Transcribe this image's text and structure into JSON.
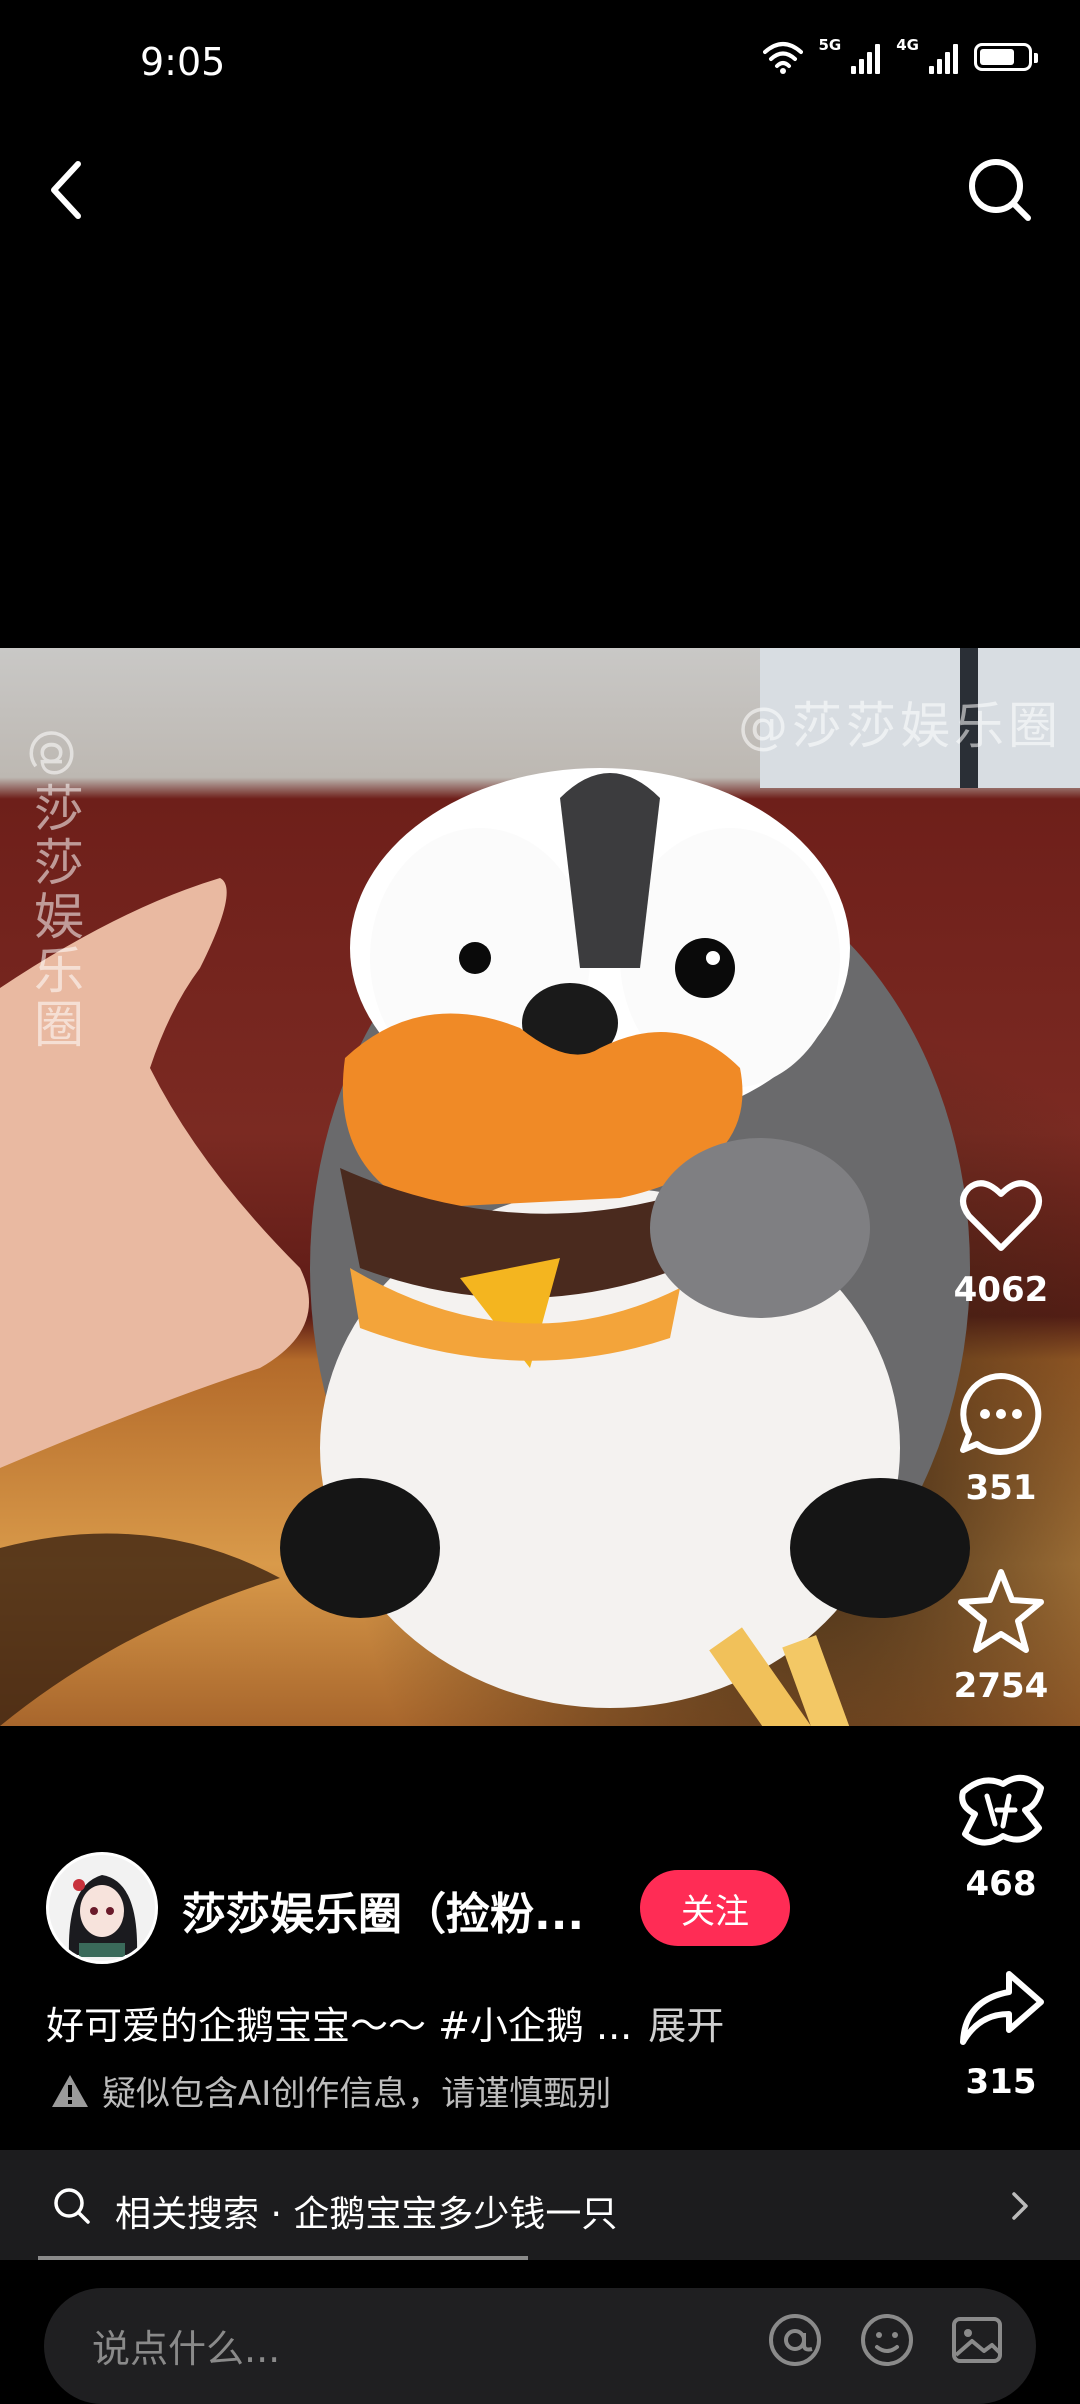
{
  "status_bar": {
    "time": "9:05",
    "net1": "5G",
    "net2": "4G"
  },
  "video": {
    "watermark_top": "@莎莎娱乐圈",
    "watermark_side": "@莎莎娱乐圈"
  },
  "actions": {
    "like_count": "4062",
    "comment_count": "351",
    "favorite_count": "2754",
    "recommend_count": "468",
    "share_count": "315"
  },
  "author": {
    "name": "莎莎娱乐圈（捡粉...",
    "follow_label": "关注"
  },
  "caption": {
    "text": "好可爱的企鹅宝宝～～ #小企鹅 ...",
    "expand_label": "展开"
  },
  "ai_notice": "疑似包含AI创作信息，请谨慎甄别",
  "related_search": {
    "text": "相关搜索 · 企鹅宝宝多少钱一只"
  },
  "comment_input": {
    "placeholder": "说点什么..."
  },
  "colors": {
    "follow_button": "#ff2c55",
    "background": "#000000"
  }
}
